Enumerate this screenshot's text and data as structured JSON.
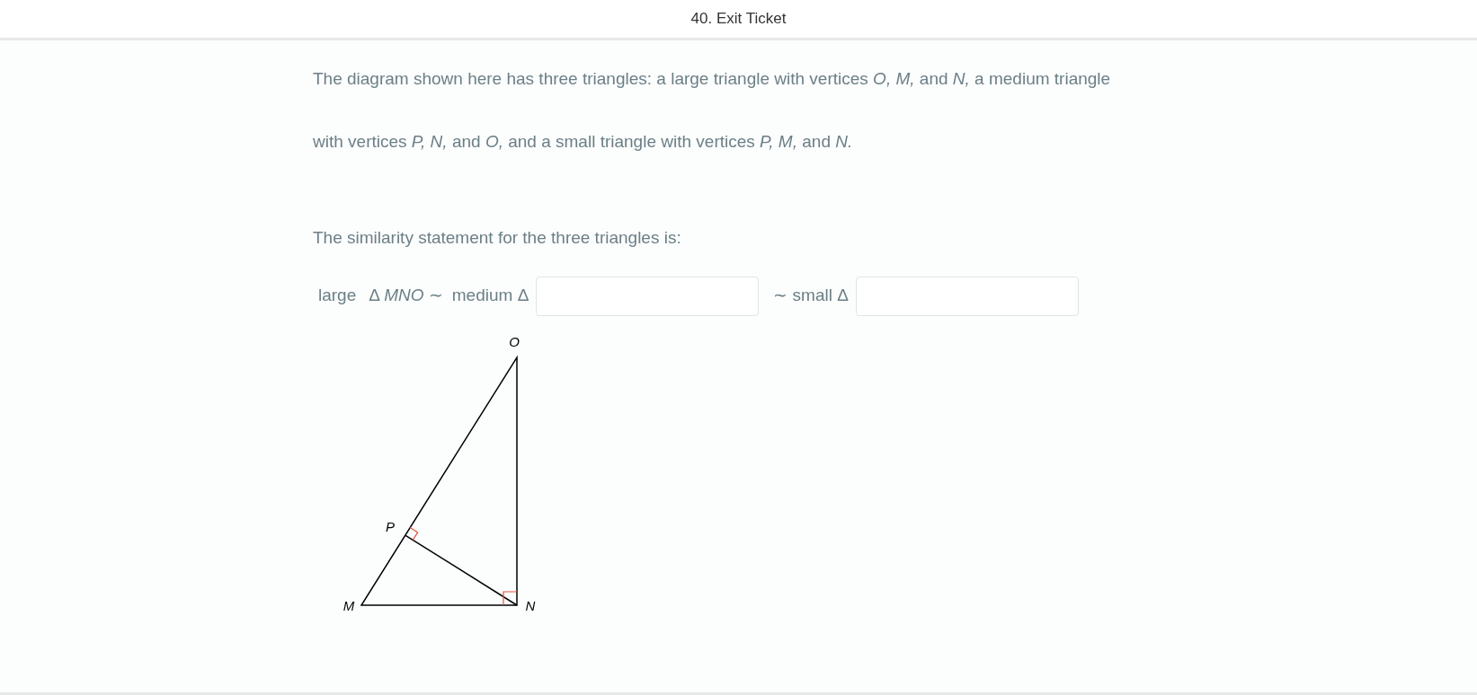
{
  "header": {
    "title": "40. Exit Ticket"
  },
  "question": {
    "intro": "The diagram shown here has three triangles: a large triangle with vertices *O,* *M,* and *N,* a medium triangle with vertices *P,* *N,* and *O,* and a small triangle with vertices *P,* *M,* and *N.*",
    "prompt": "The similarity statement for the three triangles is:",
    "statement": {
      "large_label": "large",
      "large_triangle": "Δ *MNO* ∼",
      "medium_label": "medium Δ",
      "small_label": "∼ small Δ"
    }
  },
  "diagram": {
    "vertex_labels": [
      {
        "kind": "O",
        "text": "O"
      },
      {
        "kind": "P",
        "text": "P"
      },
      {
        "kind": "M",
        "text": "M"
      },
      {
        "kind": "N",
        "text": "N"
      }
    ]
  }
}
